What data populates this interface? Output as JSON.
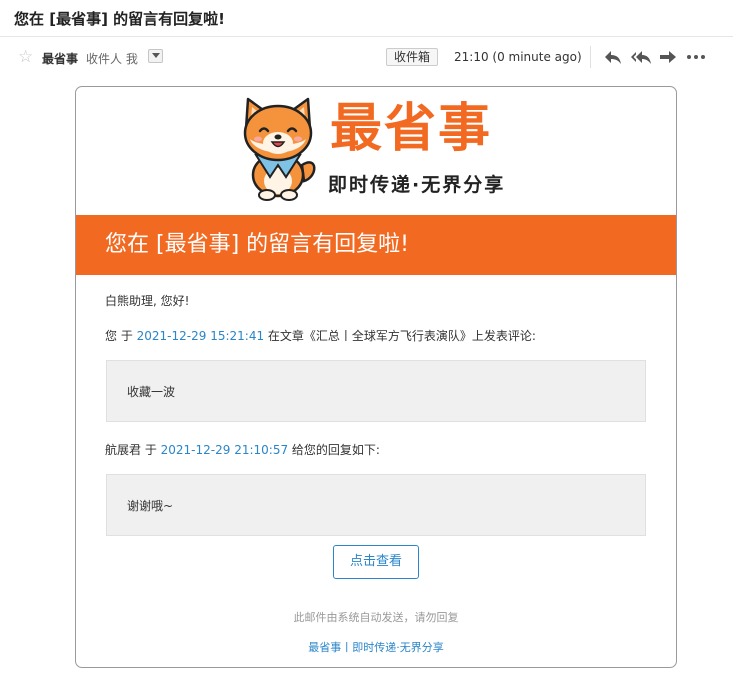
{
  "email": {
    "subject": "您在 [最省事] 的留言有回复啦!",
    "sender": "最省事",
    "recipient_label": "收件人 我",
    "folder": "收件箱",
    "time": "21:10 (0 minute ago)"
  },
  "card": {
    "brand_name": "最省事",
    "brand_slogan": "即时传递·无界分享",
    "banner_title": "您在 [最省事] 的留言有回复啦!",
    "greeting": "白熊助理, 您好!",
    "line1_prefix": "您 于 ",
    "line1_date": "2021-12-29 15:21:41",
    "line1_suffix": " 在文章《汇总丨全球军方飞行表演队》上发表评论:",
    "comment": "收藏一波",
    "line2_prefix": "航展君 于 ",
    "line2_date": "2021-12-29 21:10:57",
    "line2_suffix": " 给您的回复如下:",
    "reply": "谢谢哦~",
    "button_label": "点击查看",
    "footer_note": "此邮件由系统自动发送，请勿回复",
    "footer_link": "最省事丨即时传递·无界分享"
  },
  "icons": [
    "star-icon",
    "chevron-down-icon",
    "reply-icon",
    "reply-all-icon",
    "forward-icon",
    "more-icon",
    "shiba-dog-logo"
  ],
  "colors": {
    "brand_orange": "#f26a21",
    "link_blue": "#2a85c9"
  }
}
